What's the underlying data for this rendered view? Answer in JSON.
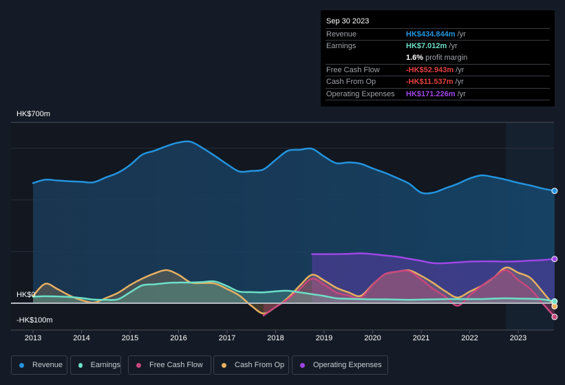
{
  "tooltip": {
    "date": "Sep 30 2023",
    "rows": [
      {
        "label": "Revenue",
        "value": "HK$434.844m",
        "unit": " /yr",
        "color": "#2394df"
      },
      {
        "label": "Earnings",
        "value": "HK$7.012m",
        "unit": " /yr",
        "color": "#6de0c8"
      },
      {
        "label": "",
        "value": "1.6%",
        "unit": " profit margin",
        "color": "#ffffff"
      },
      {
        "label": "Free Cash Flow",
        "value": "-HK$52.943m",
        "unit": " /yr",
        "color": "#e64141"
      },
      {
        "label": "Cash From Op",
        "value": "-HK$11.537m",
        "unit": " /yr",
        "color": "#e64141"
      },
      {
        "label": "Operating Expenses",
        "value": "HK$171.226m",
        "unit": " /yr",
        "color": "#a046e6"
      }
    ]
  },
  "legend": [
    {
      "label": "Revenue",
      "color": "#2394df"
    },
    {
      "label": "Earnings",
      "color": "#6de0c8"
    },
    {
      "label": "Free Cash Flow",
      "color": "#c8467e"
    },
    {
      "label": "Cash From Op",
      "color": "#e8b060"
    },
    {
      "label": "Operating Expenses",
      "color": "#a046e6"
    }
  ],
  "chart_data": {
    "type": "area",
    "title": "",
    "xlabel": "",
    "ylabel": "",
    "y_tick_labels": [
      "HK$700m",
      "HK$0",
      "-HK$100m"
    ],
    "x_tick_labels": [
      "2013",
      "2014",
      "2015",
      "2016",
      "2017",
      "2018",
      "2019",
      "2020",
      "2021",
      "2022",
      "2023"
    ],
    "ylim": [
      -100,
      700
    ],
    "xlim": [
      2012.55,
      2023.8
    ],
    "grid": true,
    "legend_position": "bottom",
    "forecast_shaded_from": 2022.75,
    "series": [
      {
        "name": "Revenue",
        "color": "#2394df",
        "x": [
          2013.0,
          2013.25,
          2013.5,
          2013.75,
          2014.0,
          2014.25,
          2014.5,
          2014.75,
          2015.0,
          2015.25,
          2015.5,
          2015.75,
          2016.0,
          2016.25,
          2016.5,
          2016.75,
          2017.0,
          2017.25,
          2017.5,
          2017.75,
          2018.0,
          2018.25,
          2018.5,
          2018.75,
          2019.0,
          2019.25,
          2019.5,
          2019.75,
          2020.0,
          2020.25,
          2020.5,
          2020.75,
          2021.0,
          2021.25,
          2021.5,
          2021.75,
          2022.0,
          2022.25,
          2022.5,
          2022.75,
          2023.0,
          2023.25,
          2023.5,
          2023.75
        ],
        "values": [
          465,
          478,
          475,
          472,
          470,
          468,
          487,
          505,
          535,
          575,
          590,
          608,
          622,
          625,
          600,
          570,
          538,
          510,
          512,
          518,
          555,
          590,
          594,
          598,
          568,
          542,
          545,
          540,
          522,
          505,
          485,
          463,
          428,
          428,
          445,
          462,
          483,
          495,
          488,
          478,
          466,
          456,
          444,
          435
        ]
      },
      {
        "name": "Earnings",
        "color": "#6de0c8",
        "x": [
          2013.0,
          2013.25,
          2013.5,
          2013.75,
          2014.0,
          2014.25,
          2014.5,
          2014.75,
          2015.0,
          2015.25,
          2015.5,
          2015.75,
          2016.0,
          2016.25,
          2016.5,
          2016.75,
          2017.0,
          2017.25,
          2017.5,
          2017.75,
          2018.0,
          2018.25,
          2018.5,
          2018.75,
          2019.0,
          2019.25,
          2019.5,
          2019.75,
          2020.0,
          2020.25,
          2020.5,
          2020.75,
          2021.0,
          2021.25,
          2021.5,
          2021.75,
          2022.0,
          2022.25,
          2022.5,
          2022.75,
          2023.0,
          2023.25,
          2023.5,
          2023.75
        ],
        "values": [
          25,
          27,
          26,
          24,
          20,
          14,
          13,
          15,
          42,
          69,
          73,
          78,
          80,
          80,
          82,
          84,
          66,
          45,
          43,
          42,
          46,
          48,
          42,
          35,
          28,
          19,
          17,
          16,
          15,
          15,
          14,
          13,
          14,
          15,
          16,
          16,
          16,
          16,
          18,
          19,
          18,
          17,
          15,
          7
        ]
      },
      {
        "name": "Free Cash Flow",
        "color": "#c8467e",
        "x": [
          2017.75,
          2018.0,
          2018.25,
          2018.5,
          2018.75,
          2019.0,
          2019.25,
          2019.5,
          2019.75,
          2020.0,
          2020.25,
          2020.5,
          2020.75,
          2021.0,
          2021.25,
          2021.5,
          2021.75,
          2022.0,
          2022.25,
          2022.5,
          2022.75,
          2023.0,
          2023.25,
          2023.5,
          2023.75
        ],
        "values": [
          -48,
          -15,
          15,
          55,
          95,
          72,
          42,
          30,
          20,
          70,
          112,
          122,
          124,
          92,
          55,
          25,
          -10,
          30,
          68,
          100,
          128,
          90,
          55,
          0,
          -53
        ]
      },
      {
        "name": "Cash From Op",
        "color": "#e8b060",
        "x": [
          2013.0,
          2013.25,
          2013.5,
          2013.75,
          2014.0,
          2014.25,
          2014.5,
          2014.75,
          2015.0,
          2015.25,
          2015.5,
          2015.75,
          2016.0,
          2016.25,
          2016.5,
          2016.75,
          2017.0,
          2017.25,
          2017.5,
          2017.75,
          2018.0,
          2018.25,
          2018.5,
          2018.75,
          2019.0,
          2019.25,
          2019.5,
          2019.75,
          2020.0,
          2020.25,
          2020.5,
          2020.75,
          2021.0,
          2021.25,
          2021.5,
          2021.75,
          2022.0,
          2022.25,
          2022.5,
          2022.75,
          2023.0,
          2023.25,
          2023.5,
          2023.75
        ],
        "values": [
          28,
          75,
          55,
          30,
          12,
          2,
          20,
          40,
          70,
          95,
          115,
          128,
          110,
          80,
          78,
          76,
          55,
          30,
          -10,
          -40,
          -15,
          20,
          68,
          110,
          88,
          60,
          42,
          28,
          72,
          112,
          122,
          127,
          106,
          78,
          46,
          22,
          45,
          68,
          100,
          138,
          118,
          98,
          45,
          -12
        ]
      },
      {
        "name": "Operating Expenses",
        "color": "#a046e6",
        "x": [
          2018.75,
          2019.0,
          2019.25,
          2019.5,
          2019.75,
          2020.0,
          2020.25,
          2020.5,
          2020.75,
          2021.0,
          2021.25,
          2021.5,
          2021.75,
          2022.0,
          2022.25,
          2022.5,
          2022.75,
          2023.0,
          2023.25,
          2023.5,
          2023.75
        ],
        "values": [
          190,
          190,
          190,
          191,
          193,
          190,
          185,
          180,
          172,
          164,
          155,
          155,
          158,
          161,
          162,
          162,
          161,
          162,
          165,
          167,
          171
        ]
      }
    ]
  }
}
